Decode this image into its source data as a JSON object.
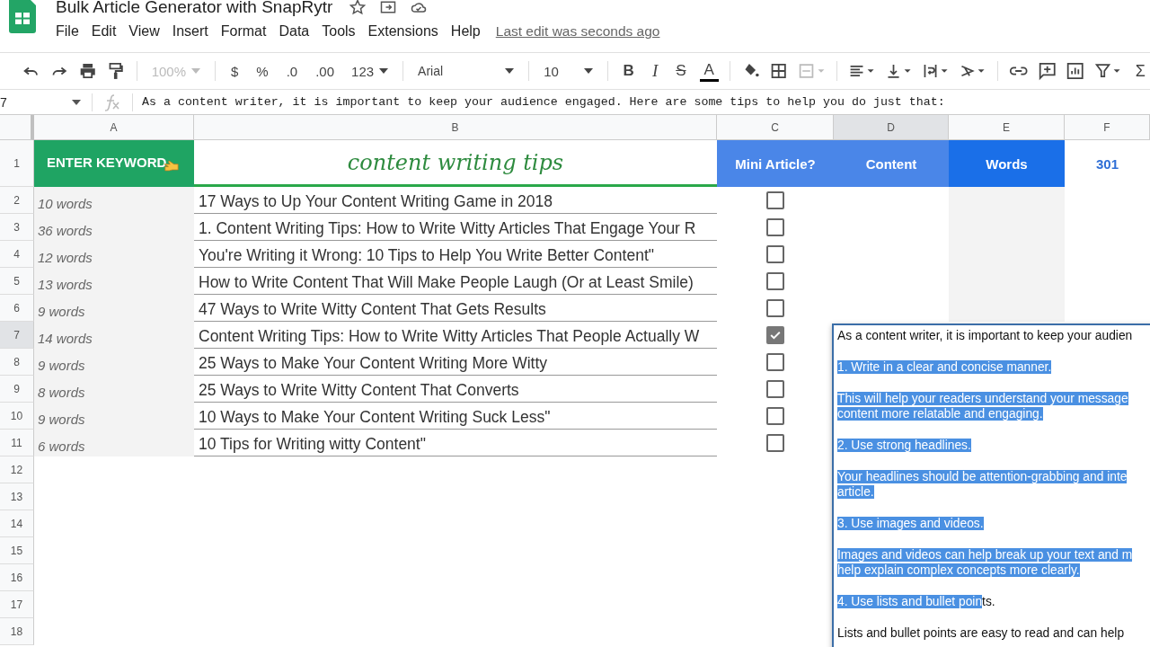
{
  "document": {
    "title": "Bulk Article Generator with SnapRytr",
    "last_edit": "Last edit was seconds ago"
  },
  "menu": [
    "File",
    "Edit",
    "View",
    "Insert",
    "Format",
    "Data",
    "Tools",
    "Extensions",
    "Help"
  ],
  "toolbar": {
    "zoom": {
      "value": "100%",
      "disabled": true
    },
    "currency": "$",
    "percent": "%",
    "decimal_less": ".0",
    "decimal_more": ".00",
    "number_format": "123",
    "font": "Arial",
    "font_size": "10",
    "bold": "B",
    "italic": "I",
    "strikethrough": "S",
    "text_color": "A",
    "sum": "Σ"
  },
  "formula_bar": {
    "cell": "7",
    "formula": "As a content writer, it is important to keep your audience engaged. Here are some tips to help you do just that:"
  },
  "columns": [
    {
      "label": "A",
      "selected": false
    },
    {
      "label": "B",
      "selected": false
    },
    {
      "label": "C",
      "selected": false
    },
    {
      "label": "D",
      "selected": true
    },
    {
      "label": "E",
      "selected": false
    },
    {
      "label": "F",
      "selected": false
    }
  ],
  "header_row": {
    "number": "1",
    "keyword": "ENTER KEYWORD",
    "topic": "content writing tips",
    "mini_article": "Mini Article?",
    "content": "Content",
    "words": "Words",
    "count": "301"
  },
  "rows": [
    {
      "number": "2",
      "words": "10 words",
      "title": "17 Ways to Up Your Content Writing Game in 2018",
      "checked": false,
      "selected": false
    },
    {
      "number": "3",
      "words": "36 words",
      "title": "1. Content Writing Tips: How to Write Witty Articles That Engage Your R",
      "checked": false,
      "selected": false
    },
    {
      "number": "4",
      "words": "12 words",
      "title": "You're Writing it Wrong: 10 Tips to Help You Write Better Content\"",
      "checked": false,
      "selected": false
    },
    {
      "number": "5",
      "words": "13 words",
      "title": "How to Write Content That Will Make People Laugh (Or at Least Smile)",
      "checked": false,
      "selected": false
    },
    {
      "number": "6",
      "words": "9 words",
      "title": "47 Ways to Write Witty Content That Gets Results",
      "checked": false,
      "selected": false
    },
    {
      "number": "7",
      "words": "14 words",
      "title": "Content Writing Tips: How to Write Witty Articles That People Actually W",
      "checked": true,
      "selected": true
    },
    {
      "number": "8",
      "words": "9 words",
      "title": "25 Ways to Make Your Content Writing More Witty",
      "checked": false,
      "selected": false
    },
    {
      "number": "9",
      "words": "8 words",
      "title": "25 Ways to Write Witty Content That Converts",
      "checked": false,
      "selected": false
    },
    {
      "number": "10",
      "words": "9 words",
      "title": "10 Ways to Make Your Content Writing Suck Less\"",
      "checked": false,
      "selected": false
    },
    {
      "number": "11",
      "words": "6 words",
      "title": "10 Tips for Writing witty Content\"",
      "checked": false,
      "selected": false
    }
  ],
  "empty_rows": [
    "12",
    "13",
    "14",
    "15",
    "16",
    "17",
    "18"
  ],
  "cell_editor": {
    "paragraphs": [
      {
        "lines": [
          {
            "text": "As a content writer, it is important to keep your audien",
            "selected": false
          }
        ]
      },
      {
        "lines": [
          {
            "text": "1. Write in a clear and concise manner.",
            "selected": true
          }
        ]
      },
      {
        "lines": [
          {
            "text": "This will help your readers understand your message",
            "selected": true
          },
          {
            "text": "content more relatable and engaging.",
            "selected": true
          }
        ]
      },
      {
        "lines": [
          {
            "text": "2. Use strong headlines.",
            "selected": true
          }
        ]
      },
      {
        "lines": [
          {
            "text": "Your headlines should be attention-grabbing and inte",
            "selected": true
          },
          {
            "text": "article.",
            "selected": true
          }
        ]
      },
      {
        "lines": [
          {
            "text": "3. Use images and videos.",
            "selected": true
          }
        ]
      },
      {
        "lines": [
          {
            "text": "Images and videos can help break up your text and m",
            "selected": true
          },
          {
            "text": "help explain complex concepts more clearly.",
            "selected": true
          }
        ]
      },
      {
        "lines": [
          {
            "text": "4. Use lists and bullet poin",
            "tail": "ts.",
            "selected": true
          }
        ]
      },
      {
        "lines": [
          {
            "text": "Lists and bullet points are easy to read and can help",
            "selected": false
          }
        ]
      }
    ]
  }
}
